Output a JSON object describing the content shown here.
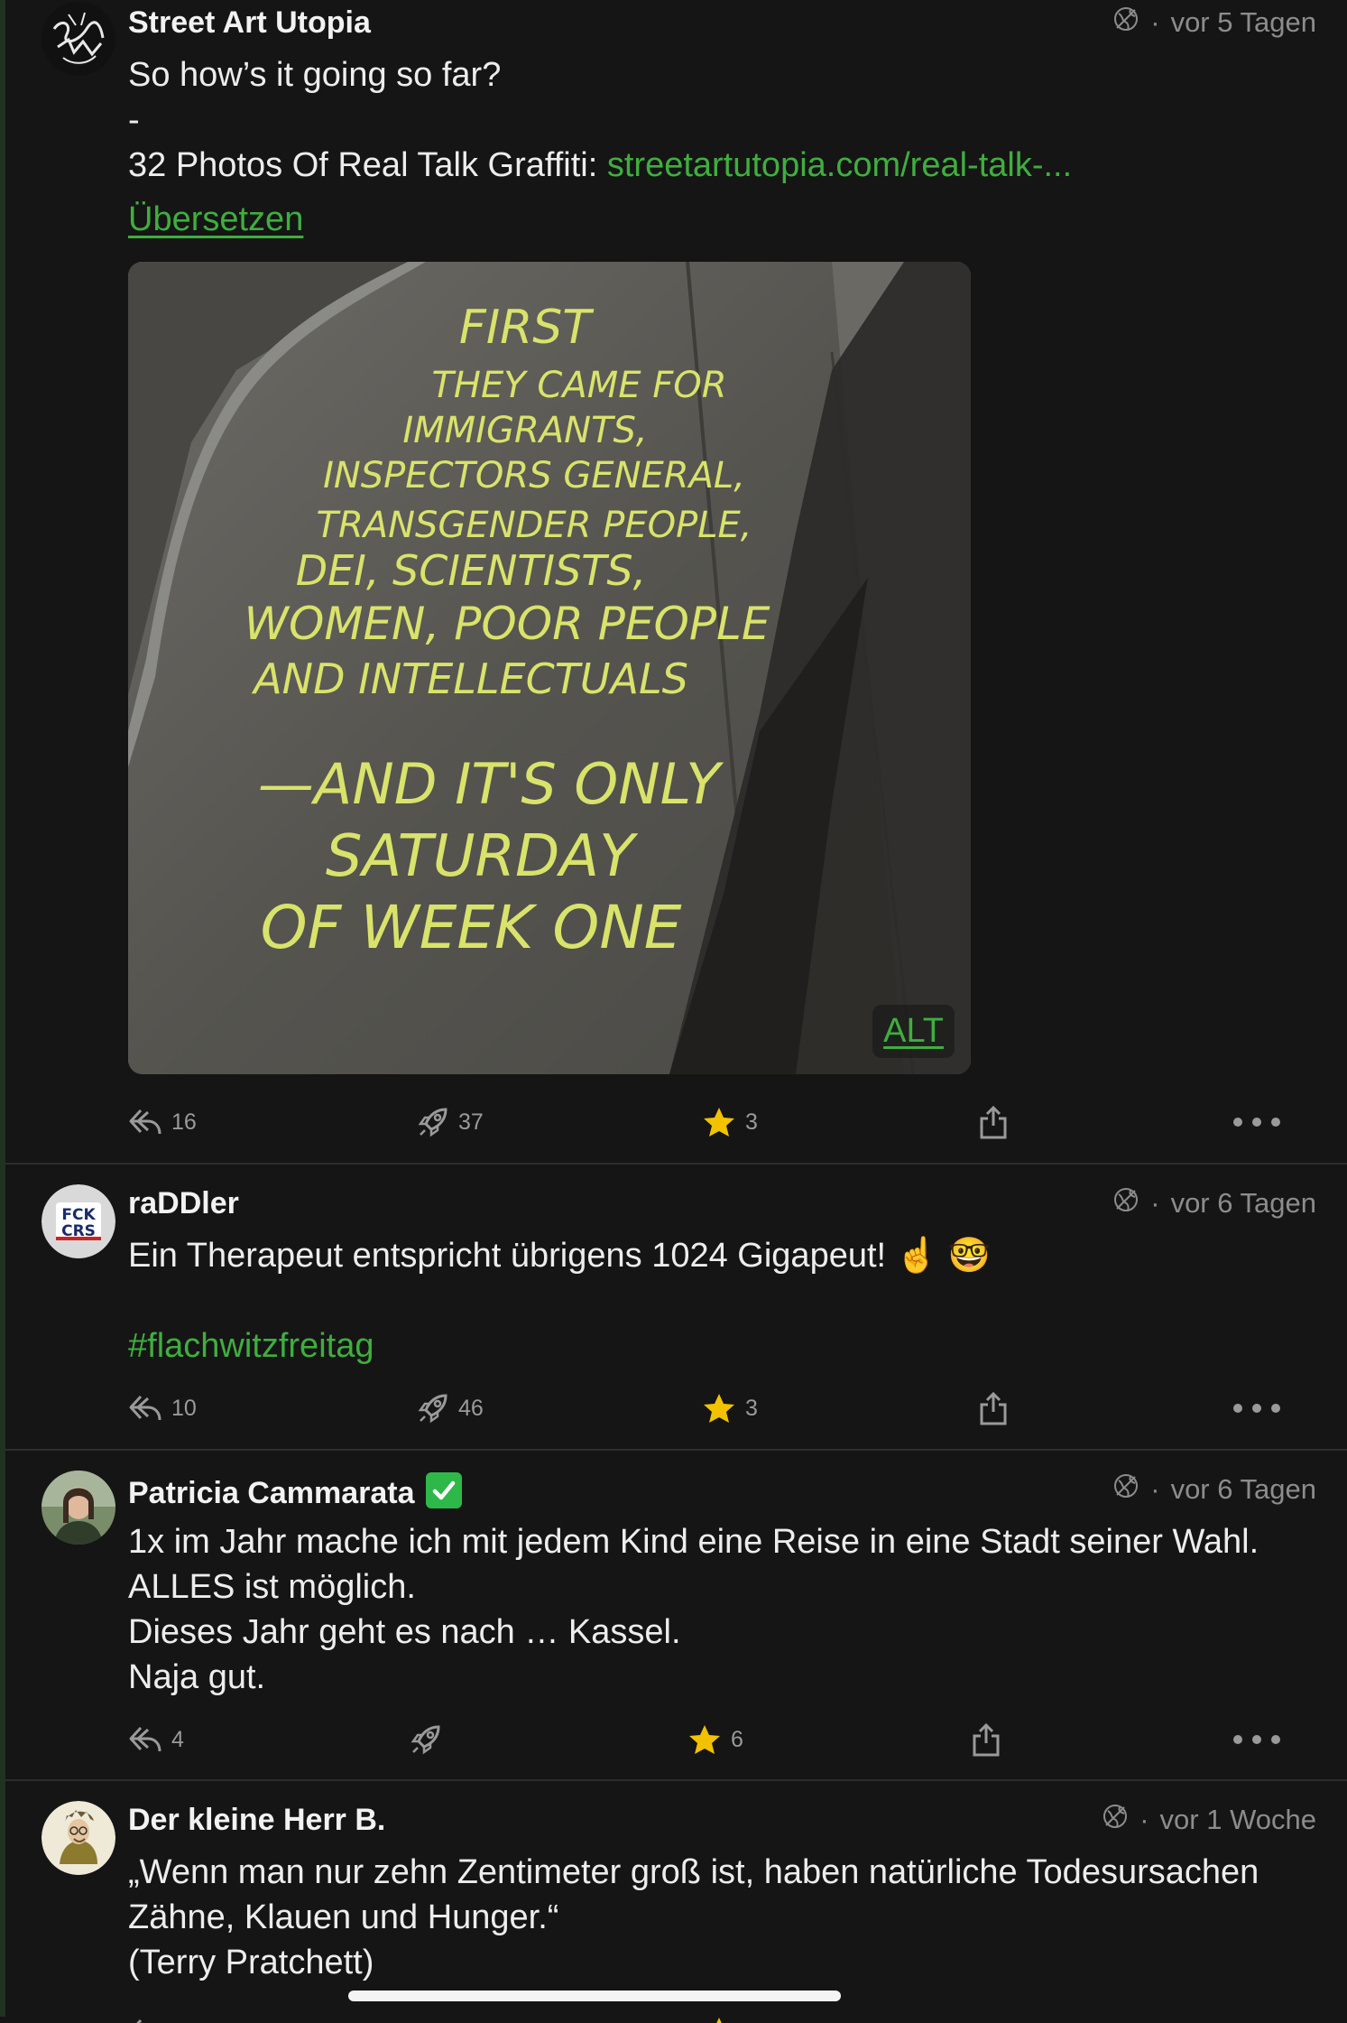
{
  "posts": [
    {
      "author": "Street Art Utopia",
      "visibility_icon": "globe-off-icon",
      "time": "vor 5 Tagen",
      "lines": [
        "So how’s it going so far?",
        "-"
      ],
      "link_prefix": "32 Photos Of Real Talk Graffiti: ",
      "link_text": "streetartutopia.com/real-talk-...",
      "translate_label": "Übersetzen",
      "media": {
        "alt_label": "ALT",
        "chalk_text": [
          "FIRST",
          "THEY CAME FOR",
          "IMMIGRANTS,",
          "INSPECTORS GENERAL,",
          "TRANSGENDER PEOPLE,",
          "DEI, SCIENTISTS,",
          "WOMEN, POOR PEOPLE",
          "AND INTELLECTUALS",
          "—AND IT'S ONLY",
          "SATURDAY",
          "OF WEEK ONE"
        ]
      },
      "counts": {
        "replies": "16",
        "boosts": "37",
        "favourites": "3"
      }
    },
    {
      "author": "raDDler",
      "avatar_text": [
        "FCK",
        "CRS"
      ],
      "time": "vor 6 Tagen",
      "line": "Ein Therapeut entspricht übrigens 1024 Gigapeut! ☝️ 🤓",
      "hashtag": "#flachwitzfreitag",
      "counts": {
        "replies": "10",
        "boosts": "46",
        "favourites": "3"
      }
    },
    {
      "author": "Patricia Cammarata",
      "verified_icon": "verified-check-icon",
      "time": "vor 6 Tagen",
      "lines": [
        "1x im Jahr mache ich mit jedem Kind eine Reise in eine Stadt seiner Wahl.",
        "ALLES ist möglich.",
        "Dieses Jahr geht es nach … Kassel.",
        "Naja gut."
      ],
      "counts": {
        "replies": "4",
        "favourites": "6"
      }
    },
    {
      "author": "Der kleine Herr B.",
      "time": "vor 1 Woche",
      "lines": [
        "„Wenn man nur zehn Zentimeter groß ist, haben natürliche Todesursachen Zähne, Klauen und Hunger.“",
        "(Terry Pratchett)"
      ]
    }
  ],
  "meta_separator": "·",
  "colors": {
    "background": "#151515",
    "accent": "#3fae3f",
    "star": "#f2c200",
    "muted": "#8c8c8c"
  }
}
